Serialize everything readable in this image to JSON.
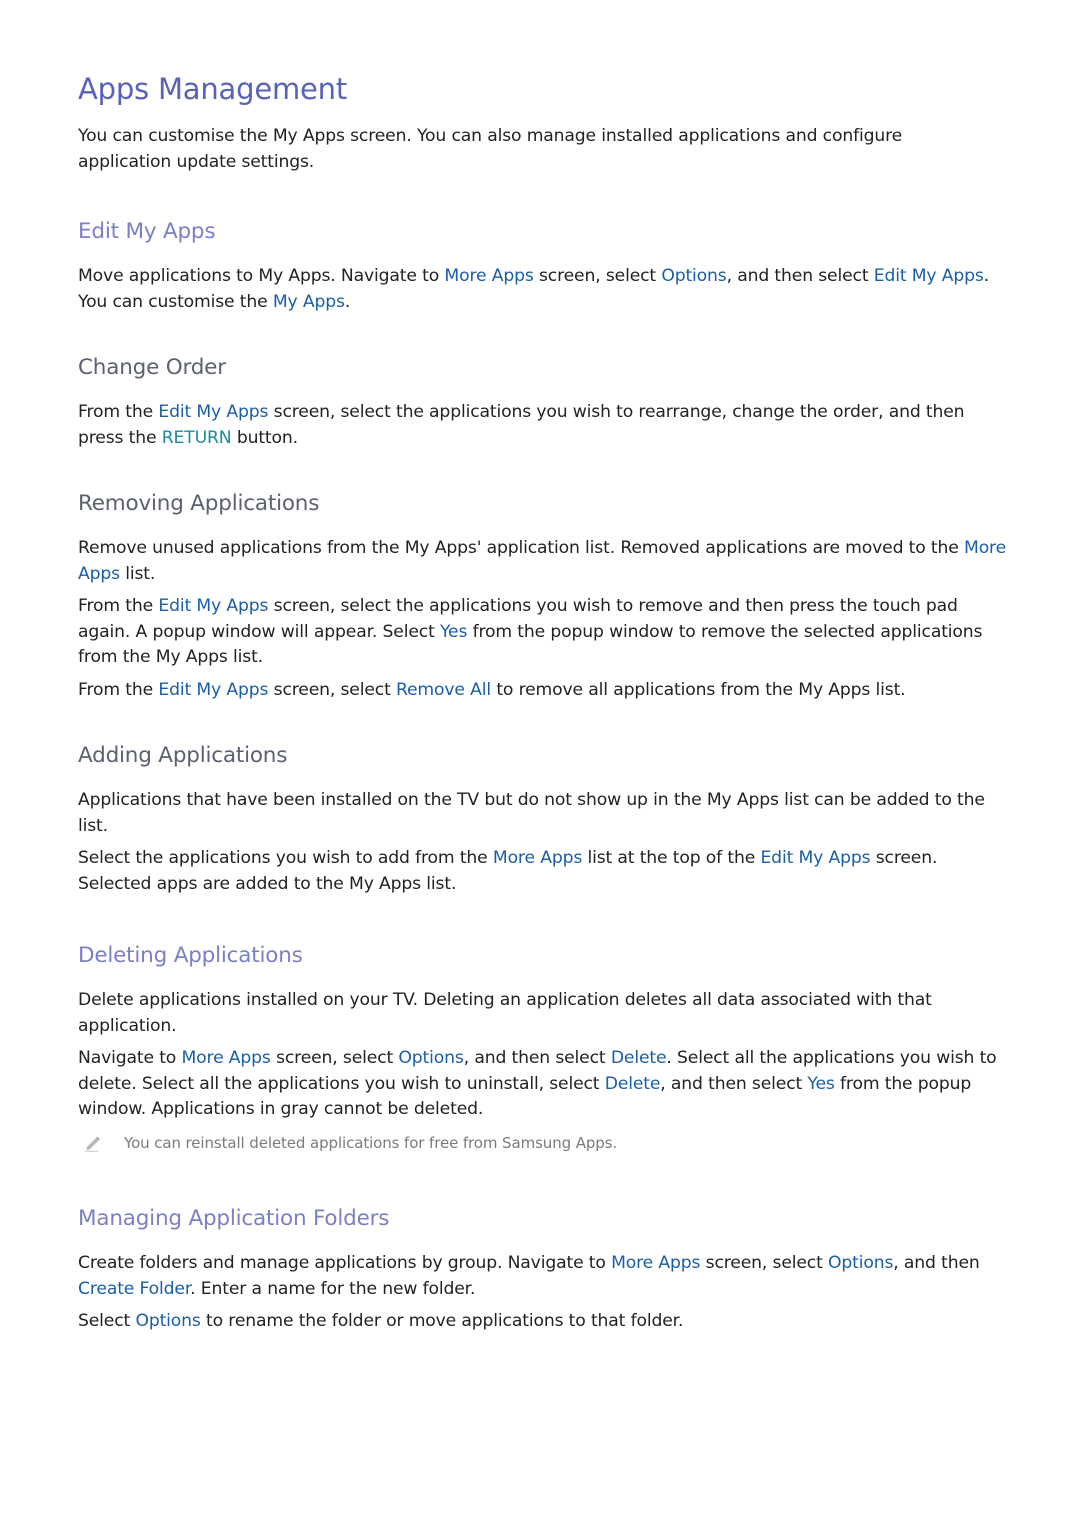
{
  "title": "Apps Management",
  "intro": {
    "l1": "You can customise the My Apps screen. You can also manage installed applications and configure",
    "l2": "application update settings."
  },
  "edit_my_apps": {
    "heading": "Edit My Apps",
    "p1": {
      "t1": "Move applications to My Apps. Navigate to ",
      "k1": "More Apps",
      "t2": " screen, select ",
      "k2": "Options",
      "t3": ", and then select ",
      "k3": "Edit My Apps",
      "t4": ". You can customise the ",
      "k4": "My Apps",
      "t5": "."
    }
  },
  "change_order": {
    "heading": "Change Order",
    "p1": {
      "t1": "From the ",
      "k1": "Edit My Apps",
      "t2": " screen, select the applications you wish to rearrange, change the order, and then press the ",
      "k2": "RETURN",
      "t3": " button."
    }
  },
  "removing": {
    "heading": "Removing Applications",
    "p1": {
      "t1": "Remove unused applications from the My Apps' application list. Removed applications are moved to the ",
      "k1": "More Apps",
      "t2": " list."
    },
    "p2": {
      "t1": "From the ",
      "k1": "Edit My Apps",
      "t2": " screen, select the applications you wish to remove and then press the touch pad again. A popup window will appear. Select ",
      "k2": "Yes",
      "t3": " from the popup window to remove the selected applications from the My Apps list."
    },
    "p3": {
      "t1": "From the ",
      "k1": "Edit My Apps",
      "t2": " screen, select ",
      "k2": "Remove All",
      "t3": " to remove all applications from the My Apps list."
    }
  },
  "adding": {
    "heading": "Adding Applications",
    "p1": {
      "t1": "Applications that have been installed on the TV but do not show up in the My Apps list can be added to the list."
    },
    "p2": {
      "t1": "Select the applications you wish to add from the ",
      "k1": "More Apps",
      "t2": " list at the top of the ",
      "k2": "Edit My Apps",
      "t3": " screen. Selected apps are added to the My Apps list."
    }
  },
  "deleting": {
    "heading": "Deleting Applications",
    "p1": {
      "t1": "Delete applications installed on your TV. Deleting an application deletes all data associated with that application."
    },
    "p2": {
      "t1": "Navigate to ",
      "k1": "More Apps",
      "t2": " screen, select ",
      "k2": "Options",
      "t3": ", and then select ",
      "k3": "Delete",
      "t4": ". Select all the applications you wish to delete. Select all the applications you wish to uninstall, select ",
      "k4": "Delete",
      "t5": ", and then select ",
      "k5": "Yes",
      "t6": " from the popup window. Applications in gray cannot be deleted."
    },
    "note": "You can reinstall deleted applications for free from Samsung Apps."
  },
  "folders": {
    "heading": "Managing Application Folders",
    "p1": {
      "t1": "Create folders and manage applications by group. Navigate to ",
      "k1": "More Apps",
      "t2": " screen, select ",
      "k2": "Options",
      "t3": ", and then ",
      "k3": "Create Folder",
      "t4": ". Enter a name for the new folder."
    },
    "p2": {
      "t1": "Select ",
      "k1": "Options",
      "t2": " to rename the folder or move applications to that folder."
    }
  },
  "colors": {
    "title": "#5a61b9",
    "section_heading": "#7b80c4",
    "sub_heading": "#5c6170",
    "link": "#1b5ea8",
    "button_ref": "#1a8a9c",
    "note_text": "#7a7a80"
  }
}
